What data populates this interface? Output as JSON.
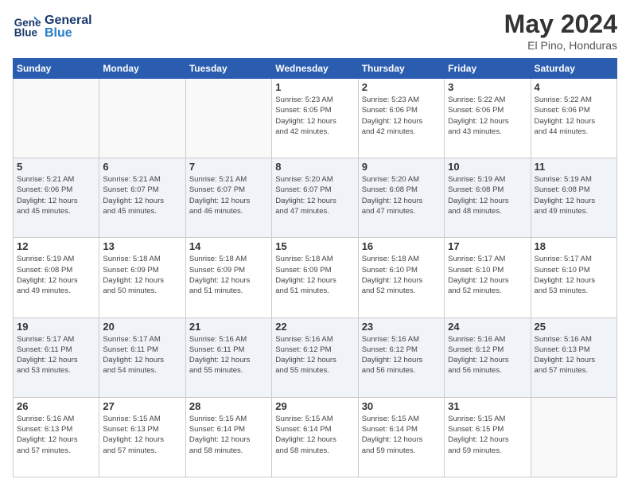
{
  "logo": {
    "line1": "General",
    "line2": "Blue"
  },
  "title": "May 2024",
  "location": "El Pino, Honduras",
  "days_of_week": [
    "Sunday",
    "Monday",
    "Tuesday",
    "Wednesday",
    "Thursday",
    "Friday",
    "Saturday"
  ],
  "weeks": [
    [
      {
        "day": "",
        "info": ""
      },
      {
        "day": "",
        "info": ""
      },
      {
        "day": "",
        "info": ""
      },
      {
        "day": "1",
        "info": "Sunrise: 5:23 AM\nSunset: 6:05 PM\nDaylight: 12 hours\nand 42 minutes."
      },
      {
        "day": "2",
        "info": "Sunrise: 5:23 AM\nSunset: 6:06 PM\nDaylight: 12 hours\nand 42 minutes."
      },
      {
        "day": "3",
        "info": "Sunrise: 5:22 AM\nSunset: 6:06 PM\nDaylight: 12 hours\nand 43 minutes."
      },
      {
        "day": "4",
        "info": "Sunrise: 5:22 AM\nSunset: 6:06 PM\nDaylight: 12 hours\nand 44 minutes."
      }
    ],
    [
      {
        "day": "5",
        "info": "Sunrise: 5:21 AM\nSunset: 6:06 PM\nDaylight: 12 hours\nand 45 minutes."
      },
      {
        "day": "6",
        "info": "Sunrise: 5:21 AM\nSunset: 6:07 PM\nDaylight: 12 hours\nand 45 minutes."
      },
      {
        "day": "7",
        "info": "Sunrise: 5:21 AM\nSunset: 6:07 PM\nDaylight: 12 hours\nand 46 minutes."
      },
      {
        "day": "8",
        "info": "Sunrise: 5:20 AM\nSunset: 6:07 PM\nDaylight: 12 hours\nand 47 minutes."
      },
      {
        "day": "9",
        "info": "Sunrise: 5:20 AM\nSunset: 6:08 PM\nDaylight: 12 hours\nand 47 minutes."
      },
      {
        "day": "10",
        "info": "Sunrise: 5:19 AM\nSunset: 6:08 PM\nDaylight: 12 hours\nand 48 minutes."
      },
      {
        "day": "11",
        "info": "Sunrise: 5:19 AM\nSunset: 6:08 PM\nDaylight: 12 hours\nand 49 minutes."
      }
    ],
    [
      {
        "day": "12",
        "info": "Sunrise: 5:19 AM\nSunset: 6:08 PM\nDaylight: 12 hours\nand 49 minutes."
      },
      {
        "day": "13",
        "info": "Sunrise: 5:18 AM\nSunset: 6:09 PM\nDaylight: 12 hours\nand 50 minutes."
      },
      {
        "day": "14",
        "info": "Sunrise: 5:18 AM\nSunset: 6:09 PM\nDaylight: 12 hours\nand 51 minutes."
      },
      {
        "day": "15",
        "info": "Sunrise: 5:18 AM\nSunset: 6:09 PM\nDaylight: 12 hours\nand 51 minutes."
      },
      {
        "day": "16",
        "info": "Sunrise: 5:18 AM\nSunset: 6:10 PM\nDaylight: 12 hours\nand 52 minutes."
      },
      {
        "day": "17",
        "info": "Sunrise: 5:17 AM\nSunset: 6:10 PM\nDaylight: 12 hours\nand 52 minutes."
      },
      {
        "day": "18",
        "info": "Sunrise: 5:17 AM\nSunset: 6:10 PM\nDaylight: 12 hours\nand 53 minutes."
      }
    ],
    [
      {
        "day": "19",
        "info": "Sunrise: 5:17 AM\nSunset: 6:11 PM\nDaylight: 12 hours\nand 53 minutes."
      },
      {
        "day": "20",
        "info": "Sunrise: 5:17 AM\nSunset: 6:11 PM\nDaylight: 12 hours\nand 54 minutes."
      },
      {
        "day": "21",
        "info": "Sunrise: 5:16 AM\nSunset: 6:11 PM\nDaylight: 12 hours\nand 55 minutes."
      },
      {
        "day": "22",
        "info": "Sunrise: 5:16 AM\nSunset: 6:12 PM\nDaylight: 12 hours\nand 55 minutes."
      },
      {
        "day": "23",
        "info": "Sunrise: 5:16 AM\nSunset: 6:12 PM\nDaylight: 12 hours\nand 56 minutes."
      },
      {
        "day": "24",
        "info": "Sunrise: 5:16 AM\nSunset: 6:12 PM\nDaylight: 12 hours\nand 56 minutes."
      },
      {
        "day": "25",
        "info": "Sunrise: 5:16 AM\nSunset: 6:13 PM\nDaylight: 12 hours\nand 57 minutes."
      }
    ],
    [
      {
        "day": "26",
        "info": "Sunrise: 5:16 AM\nSunset: 6:13 PM\nDaylight: 12 hours\nand 57 minutes."
      },
      {
        "day": "27",
        "info": "Sunrise: 5:15 AM\nSunset: 6:13 PM\nDaylight: 12 hours\nand 57 minutes."
      },
      {
        "day": "28",
        "info": "Sunrise: 5:15 AM\nSunset: 6:14 PM\nDaylight: 12 hours\nand 58 minutes."
      },
      {
        "day": "29",
        "info": "Sunrise: 5:15 AM\nSunset: 6:14 PM\nDaylight: 12 hours\nand 58 minutes."
      },
      {
        "day": "30",
        "info": "Sunrise: 5:15 AM\nSunset: 6:14 PM\nDaylight: 12 hours\nand 59 minutes."
      },
      {
        "day": "31",
        "info": "Sunrise: 5:15 AM\nSunset: 6:15 PM\nDaylight: 12 hours\nand 59 minutes."
      },
      {
        "day": "",
        "info": ""
      }
    ]
  ]
}
